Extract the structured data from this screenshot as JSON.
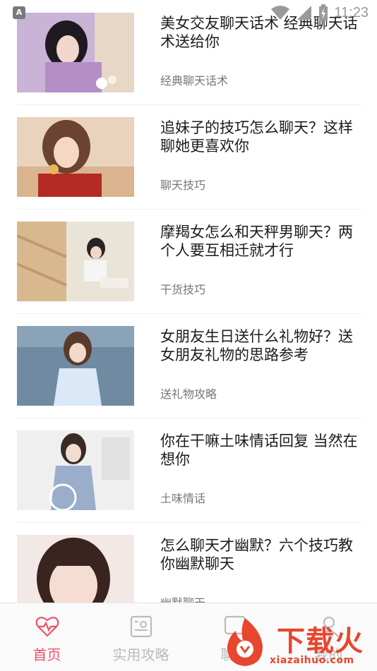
{
  "status_bar": {
    "app_indicator": "A",
    "time": "11:23",
    "icons": [
      "wifi-icon",
      "signal-icon",
      "battery-icon"
    ]
  },
  "articles": [
    {
      "title": "美女交友聊天话术 经典聊天话术送给你",
      "category": "经典聊天话术"
    },
    {
      "title": "追妹子的技巧怎么聊天？这样聊她更喜欢你",
      "category": "聊天技巧"
    },
    {
      "title": "摩羯女怎么和天秤男聊天？两个人要互相迁就才行",
      "category": "干货技巧"
    },
    {
      "title": "女朋友生日送什么礼物好？送女朋友礼物的思路参考",
      "category": "送礼物攻略"
    },
    {
      "title": "你在干嘛土味情话回复 当然在想你",
      "category": "土味情话"
    },
    {
      "title": "怎么聊天才幽默？六个技巧教你幽默聊天",
      "category": "幽默聊天"
    }
  ],
  "tabs": [
    {
      "label": "首页",
      "icon": "heart-pulse-icon",
      "active": true
    },
    {
      "label": "实用攻略",
      "icon": "guide-icon",
      "active": false
    },
    {
      "label": "聊天",
      "icon": "chat-icon",
      "active": false
    },
    {
      "label": "我的",
      "icon": "profile-icon",
      "active": false
    }
  ],
  "watermark": {
    "text": "下载火",
    "subtext": "xiazaihuo.com"
  },
  "colors": {
    "accent": "#f0506e",
    "tab_inactive": "#bbbbbb",
    "watermark": "#e8462e"
  }
}
